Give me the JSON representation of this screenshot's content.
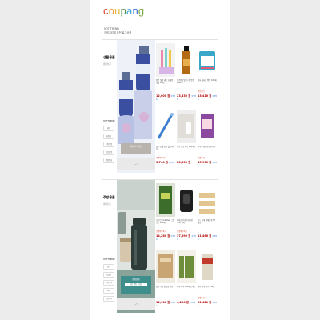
{
  "logo": {
    "letters": [
      "c",
      "o",
      "u",
      "p",
      "a",
      "n",
      "g"
    ],
    "colors": [
      "#d9412f",
      "#f0932b",
      "#e6b73a",
      "#4a8d38",
      "#3aa1d8",
      "#3f6ad8",
      "#7aa743"
    ]
  },
  "hot_trend": {
    "label": "HOT TREND",
    "sub": "카테고리별 추천 로그상품"
  },
  "sections": [
    {
      "title": "생활용품",
      "subtitle": "캠페인기",
      "hot_label": "HOTTREND",
      "tags": [
        "세제",
        "화장지",
        "주방용품",
        "욕실용품",
        "생활잡화"
      ],
      "hero_caption": "최대30% 할인",
      "hero_sub": "",
      "pager": "1 / 3",
      "items": [
        {
          "name": "윰킨 칫솔 세트 휴대용 칫솔 6개입",
          "badge": "",
          "price": "12,000 원",
          "rocket": "로켓배송"
        },
        {
          "name": "모로칸오일 트리트먼트 100ml",
          "badge": "",
          "price": "23,330 원",
          "rocket": "로켓배송"
        },
        {
          "name": "탐사 물티슈 캡형 100매",
          "badge": "쿠폰할인",
          "price": "13,410 원",
          "rocket": "로켓배송"
        },
        {
          "name": "창문 틈새 청소 솔 브러쉬",
          "badge": "로켓와우특가",
          "price": "3,740 원",
          "rocket": "로켓배송"
        },
        {
          "name": "무선 진동 파스 마사지기",
          "badge": "",
          "price": "28,330 원",
          "rocket": ""
        },
        {
          "name": "다우니 섬유유연제 세트",
          "badge": "로켓프레시",
          "price": "15,930 원",
          "rocket": "로켓배송"
        }
      ]
    },
    {
      "title": "주방용품",
      "subtitle": "캠페인기",
      "hot_label": "HOTTREND",
      "tags": [
        "냄비",
        "텀블러",
        "조리도구",
        "식기",
        "보관용기"
      ],
      "hero_caption": "캠핑용품",
      "hero_sub": "여름 캠핑 기획전",
      "pager": "1 / 3",
      "items": [
        {
          "name": "포스트잇 Captain 그린 노트 200매",
          "badge": "로켓와우특가",
          "price": "14,260 원",
          "rocket": "로켓배송"
        },
        {
          "name": "에어프라이어 대용량 5.5L 블랙",
          "badge": "로켓와우특가",
          "price": "37,890 원",
          "rocket": "로켓배송"
        },
        {
          "name": "우드 집게 빨래집게 50개입",
          "badge": "",
          "price": "11,460 원",
          "rocket": "로켓배송"
        },
        {
          "name": "원목 수납 정리함 선반",
          "badge": "",
          "price": "12,960 원",
          "rocket": "로켓배송"
        },
        {
          "name": "녹차 티백 100개입 세트",
          "badge": "",
          "price": "4,200 원",
          "rocket": "로켓배송"
        },
        {
          "name": "일리 커피 원두 250g",
          "badge": "로켓프레시",
          "price": "22,420 원",
          "rocket": "로켓배송"
        }
      ]
    }
  ]
}
